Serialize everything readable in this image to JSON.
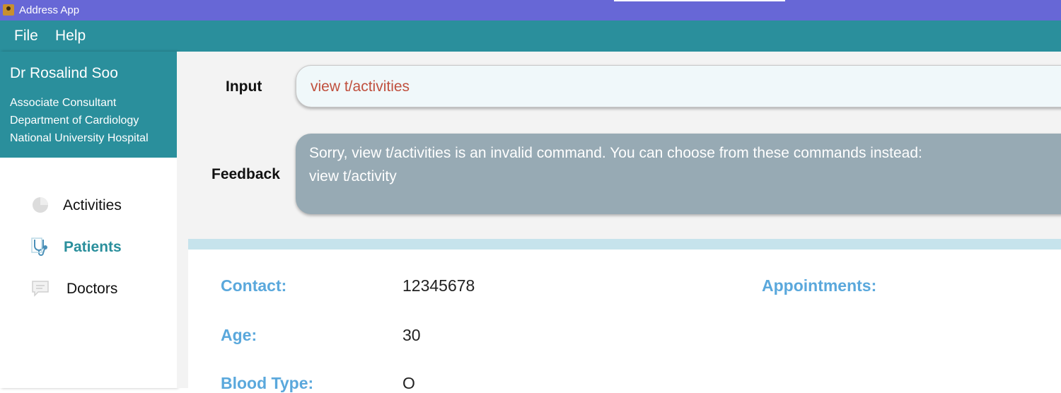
{
  "window": {
    "title": "Address App"
  },
  "menu": {
    "items": [
      "File",
      "Help"
    ]
  },
  "profile": {
    "name": "Dr Rosalind Soo",
    "lines": [
      "Associate Consultant",
      "Department of Cardiology",
      "National University Hospital"
    ]
  },
  "nav": {
    "items": [
      {
        "label": "Activities",
        "icon": "pie-chart-icon",
        "active": false
      },
      {
        "label": "Patients",
        "icon": "stethoscope-icon",
        "active": true
      },
      {
        "label": "Doctors",
        "icon": "chat-icon",
        "active": false
      }
    ]
  },
  "command": {
    "label": "Input",
    "value": "view t/activities"
  },
  "feedback": {
    "label": "Feedback",
    "lines": [
      "Sorry, view t/activities is an invalid command. You can choose from these commands instead:",
      "view t/activity"
    ]
  },
  "details": {
    "contact_label": "Contact:",
    "contact_value": "12345678",
    "age_label": "Age:",
    "age_value": "30",
    "blood_label": "Blood Type:",
    "blood_value": "O",
    "appointments_label": "Appointments:"
  },
  "colors": {
    "titlebar": "#6767d6",
    "accent": "#2a8f9c",
    "feedback_bg": "#97aab4",
    "label_blue": "#5aa8dc",
    "command_text": "#c0503e"
  }
}
